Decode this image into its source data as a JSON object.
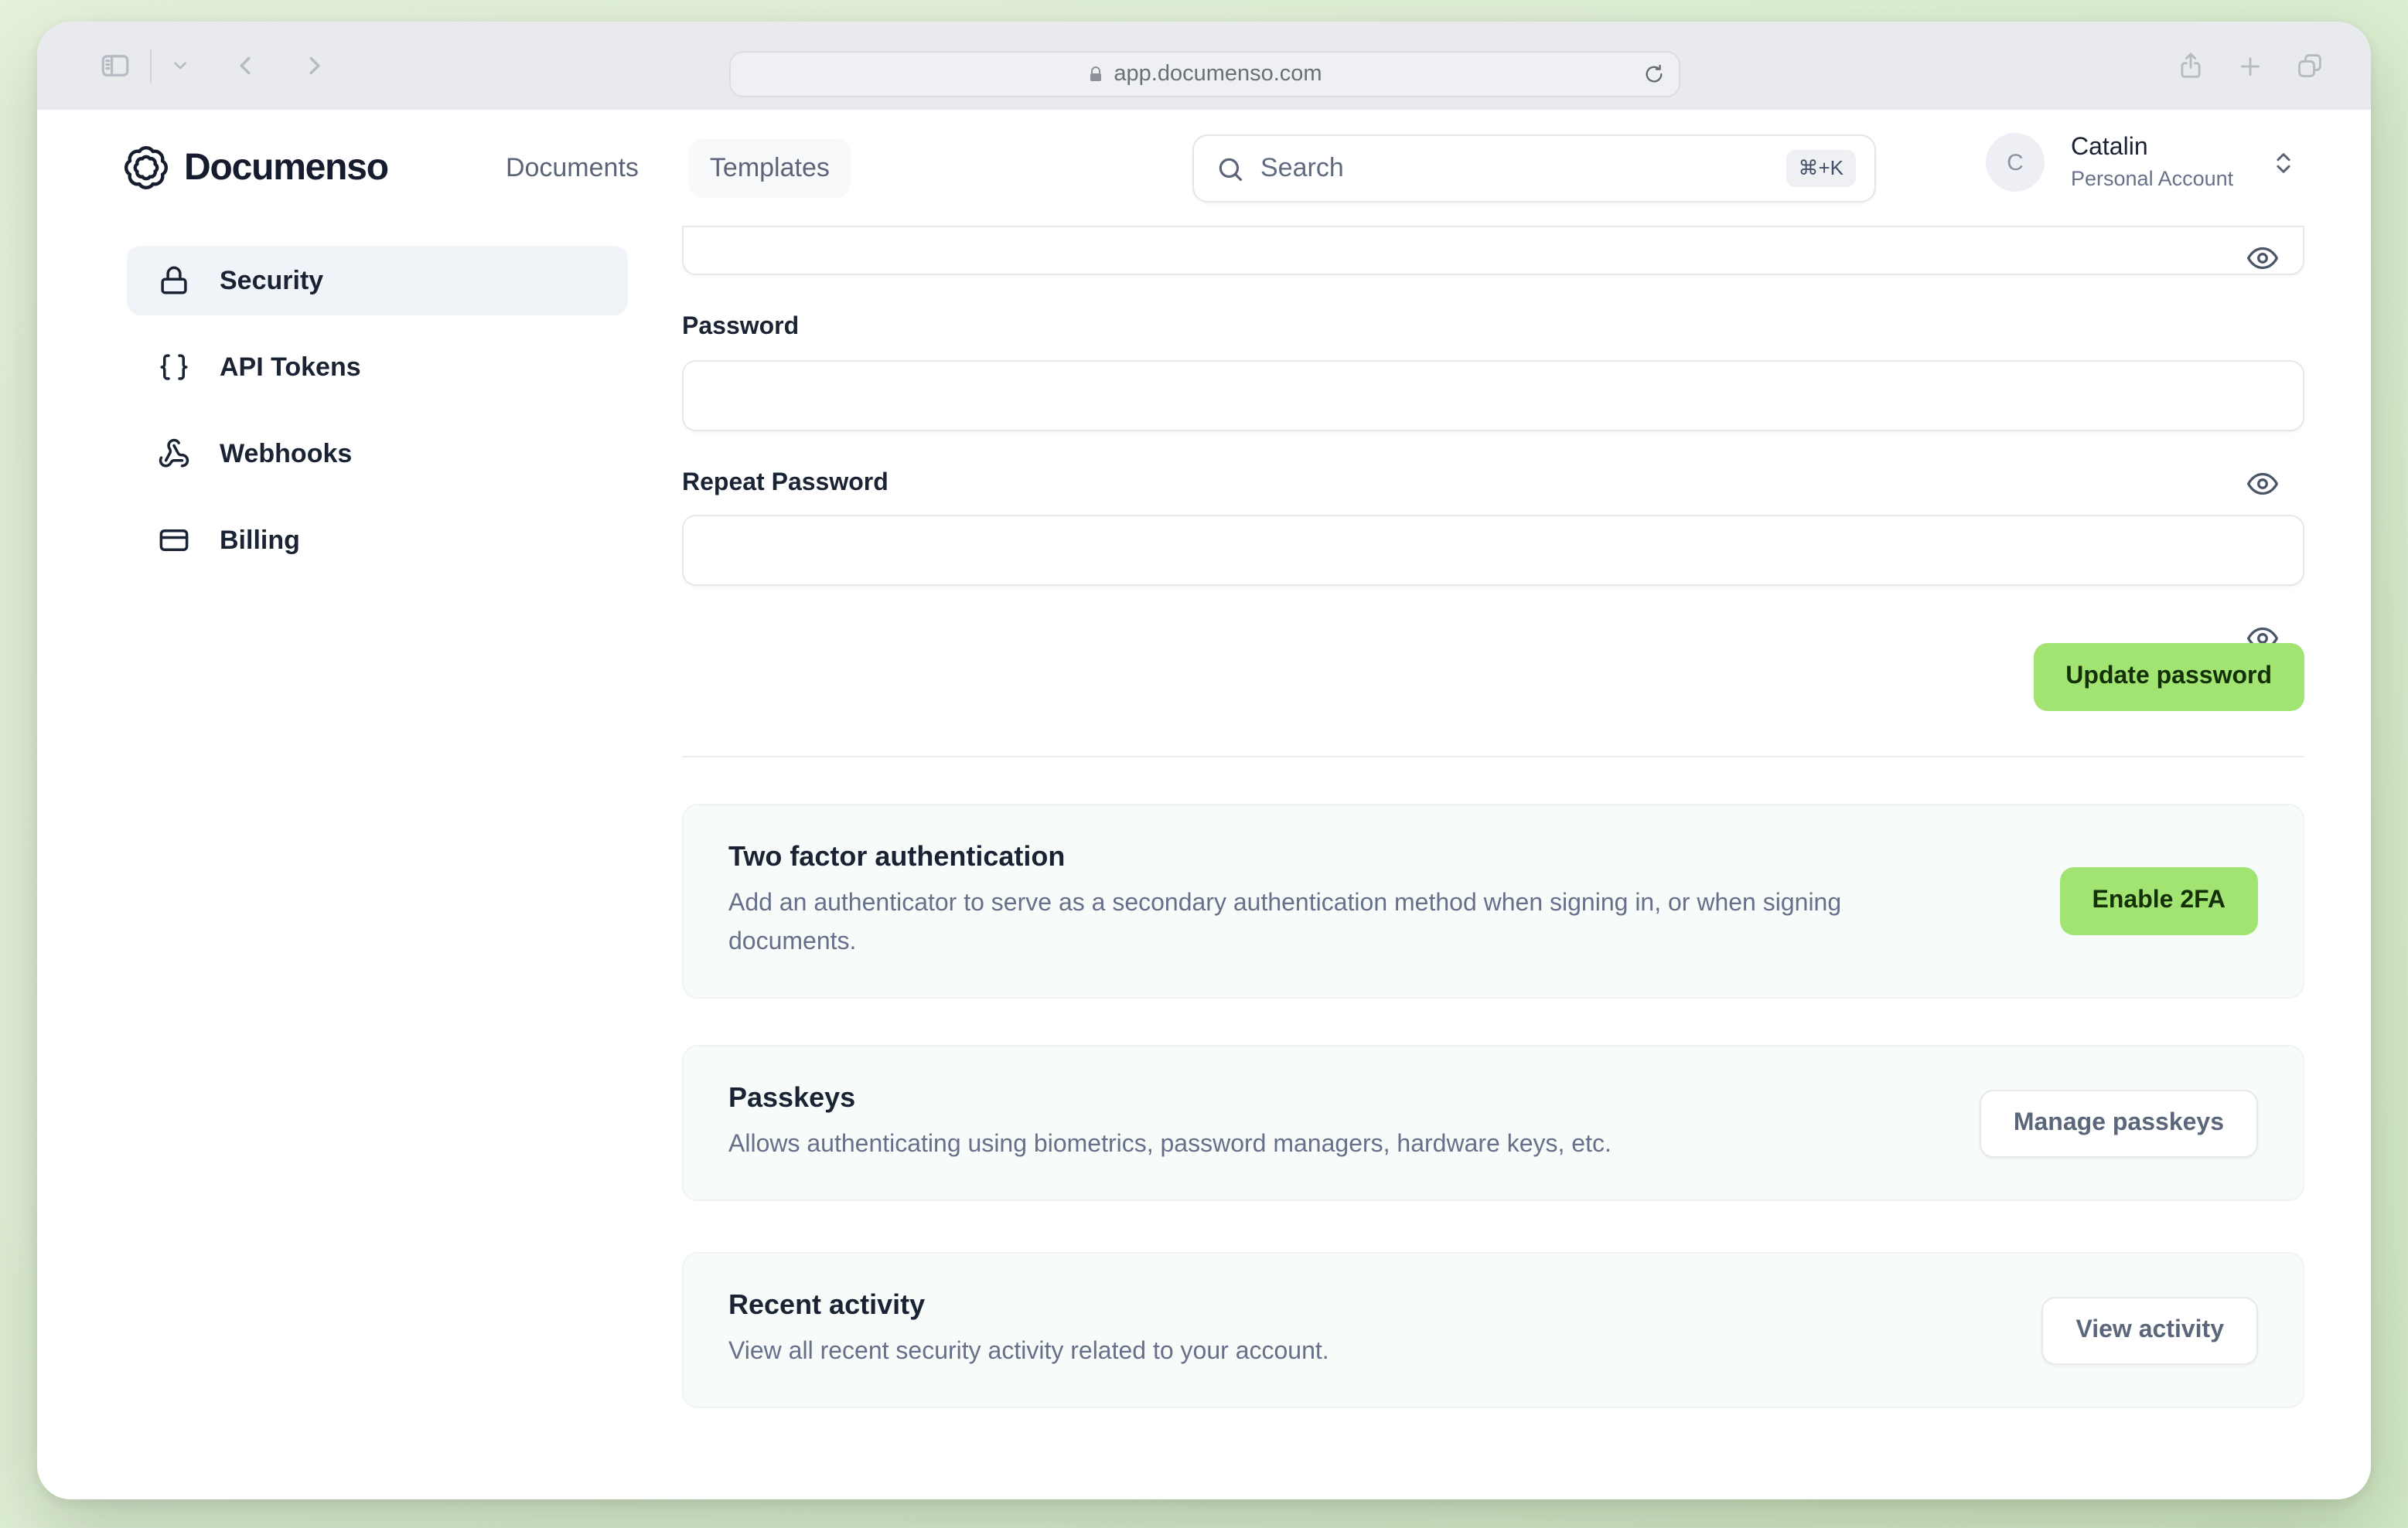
{
  "browser": {
    "url": "app.documenso.com"
  },
  "header": {
    "brand": "Documenso",
    "nav": [
      {
        "label": "Documents"
      },
      {
        "label": "Templates"
      }
    ],
    "search": {
      "placeholder": "Search",
      "shortcut": "⌘+K"
    },
    "account": {
      "initial": "C",
      "name": "Catalin",
      "type": "Personal Account"
    }
  },
  "sidebar": {
    "items": [
      {
        "label": "Security",
        "icon": "lock-icon",
        "active": true
      },
      {
        "label": "API Tokens",
        "icon": "braces-icon",
        "active": false
      },
      {
        "label": "Webhooks",
        "icon": "webhook-icon",
        "active": false
      },
      {
        "label": "Billing",
        "icon": "credit-card-icon",
        "active": false
      }
    ]
  },
  "main": {
    "password_form": {
      "current_password_value": "",
      "password_label": "Password",
      "password_value": "",
      "repeat_password_label": "Repeat Password",
      "repeat_password_value": "",
      "submit_label": "Update password"
    },
    "sections": [
      {
        "title": "Two factor authentication",
        "description": "Add an authenticator to serve as a secondary authentication method when signing in, or when signing documents.",
        "button": "Enable 2FA",
        "button_style": "primary"
      },
      {
        "title": "Passkeys",
        "description": "Allows authenticating using biometrics, password managers, hardware keys, etc.",
        "button": "Manage passkeys",
        "button_style": "secondary"
      },
      {
        "title": "Recent activity",
        "description": "View all recent security activity related to your account.",
        "button": "View activity",
        "button_style": "secondary"
      }
    ]
  },
  "colors": {
    "accent_green": "#a2e471",
    "accent_green_text": "#143009",
    "page_background_green": "#ddeed2",
    "sidebar_selected_bg": "#f0f3f7",
    "card_bg": "#f7fbf9",
    "dark_text": "#1a2333",
    "muted_text": "#66708a"
  }
}
